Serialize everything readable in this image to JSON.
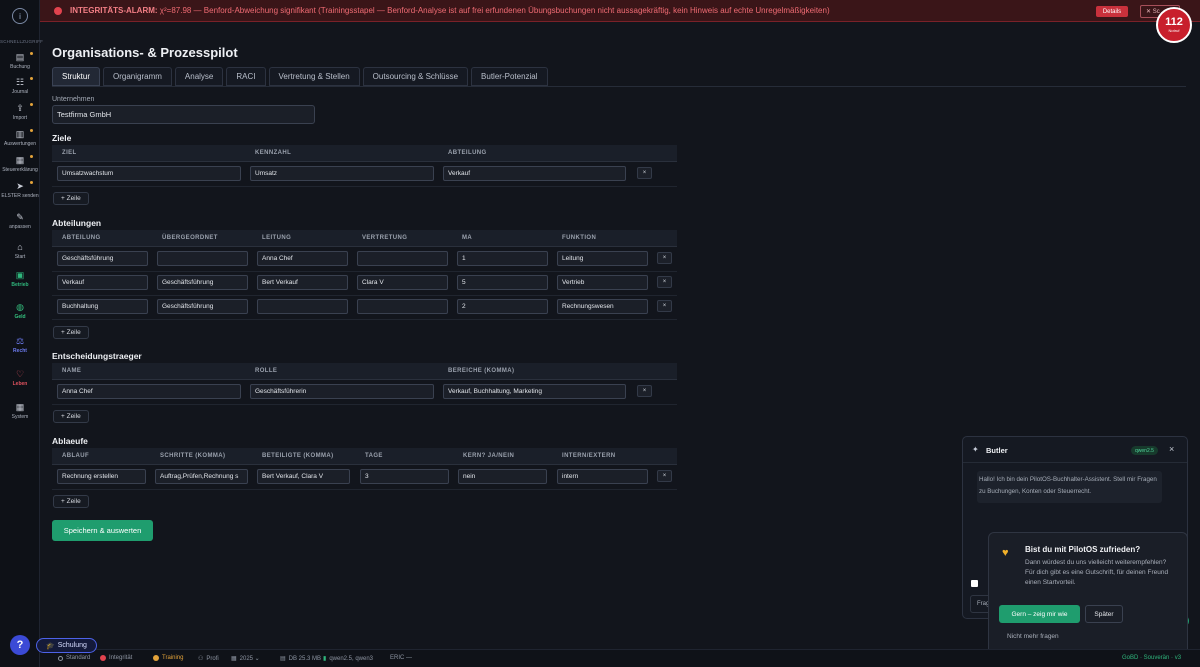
{
  "sidebar": {
    "logo": "i",
    "section": "SCHNELLZUGRIFF",
    "items": [
      {
        "label": "Buchung",
        "icon": "book-icon",
        "glyph": "▤",
        "dot": true
      },
      {
        "label": "Journal",
        "icon": "journal-icon",
        "glyph": "☷",
        "dot": true
      },
      {
        "label": "Import",
        "icon": "upload-icon",
        "glyph": "⇪",
        "dot": true
      },
      {
        "label": "Auswertungen",
        "icon": "chart-icon",
        "glyph": "▥",
        "dot": true
      },
      {
        "label": "Steuererklärung",
        "icon": "document-icon",
        "glyph": "▦",
        "dot": true
      },
      {
        "label": "ELSTER senden",
        "icon": "send-icon",
        "glyph": "➤",
        "dot": true
      },
      {
        "label": "anpassen",
        "icon": "pencil-icon",
        "glyph": "✎",
        "dot": false
      }
    ],
    "nav": [
      {
        "label": "Start",
        "icon": "home-icon",
        "glyph": "⌂",
        "color": "#c8ccd6",
        "sub": ""
      },
      {
        "label": "Betrieb",
        "icon": "briefcase-icon",
        "glyph": "▣",
        "color": "#2fb67c",
        "sub": ""
      },
      {
        "label": "Geld",
        "icon": "piggy-bank-icon",
        "glyph": "◍",
        "color": "#34c27f",
        "sub": ""
      },
      {
        "label": "Recht",
        "icon": "scales-icon",
        "glyph": "⚖",
        "color": "#6d7cf0",
        "sub": ""
      },
      {
        "label": "Leben",
        "icon": "heart-icon",
        "glyph": "♡",
        "color": "#e0525f",
        "sub": ""
      },
      {
        "label": "System",
        "icon": "grid-icon",
        "glyph": "▦",
        "color": "#c8ccd6",
        "sub": ""
      }
    ]
  },
  "alarm": {
    "label": "INTEGRITÄTS-ALARM:",
    "message": "χ²=87.98 — Benford-Abweichung signifikant (Trainingsstapel — Benford-Analyse ist auf frei erfundenen Übungsbuchungen nicht aussagekräftig, kein Hinweis auf echte Unregelmäßigkeiten)",
    "details_button": "Details",
    "close_button": "✕ Sc",
    "badge_number": "112",
    "badge_label": "Notruf"
  },
  "page": {
    "title": "Organisations- & Prozesspilot",
    "tabs": [
      "Struktur",
      "Organigramm",
      "Analyse",
      "RACI",
      "Vertretung & Stellen",
      "Outsourcing & Schlüsse",
      "Butler-Potenzial"
    ],
    "company_label": "Unternehmen",
    "company_value": "Testfirma GmbH",
    "add_row": "+ Zeile",
    "remove": "×",
    "save_button": "Speichern & auswerten"
  },
  "ziele": {
    "heading": "Ziele",
    "columns": [
      "ZIEL",
      "KENNZAHL",
      "ABTEILUNG"
    ],
    "rows": [
      [
        "Umsatzwachstum",
        "Umsatz",
        "Verkauf"
      ]
    ]
  },
  "abteilungen": {
    "heading": "Abteilungen",
    "columns": [
      "ABTEILUNG",
      "ÜBERGEORDNET",
      "LEITUNG",
      "VERTRETUNG",
      "MA",
      "FUNKTION"
    ],
    "rows": [
      [
        "Geschäftsführung",
        "",
        "Anna Chef",
        "",
        "1",
        "Leitung"
      ],
      [
        "Verkauf",
        "Geschäftsführung",
        "Bert Verkauf",
        "Clara V",
        "5",
        "Vertrieb"
      ],
      [
        "Buchhaltung",
        "Geschäftsführung",
        "",
        "",
        "2",
        "Rechnungswesen"
      ]
    ]
  },
  "entscheider": {
    "heading": "Entscheidungstraeger",
    "columns": [
      "NAME",
      "ROLLE",
      "BEREICHE (KOMMA)"
    ],
    "rows": [
      [
        "Anna Chef",
        "Geschäftsführerin",
        "Verkauf, Buchhaltung, Marketing"
      ]
    ]
  },
  "ablaeufe": {
    "heading": "Ablaeufe",
    "columns": [
      "ABLAUF",
      "SCHRITTE (KOMMA)",
      "BETEILIGTE (KOMMA)",
      "TAGE",
      "KERN? JA/NEIN",
      "INTERN/EXTERN"
    ],
    "rows": [
      [
        "Rechnung erstellen",
        "Auftrag,Prüfen,Rechnung s",
        "Bert Verkauf, Clara V",
        "3",
        "nein",
        "intern"
      ]
    ]
  },
  "butler": {
    "title": "Butler",
    "model": "qwen2.5",
    "close": "×",
    "message": "Hallo! Ich bin dein PilotOS-Buchhalter-Assistent. Stell mir Fragen zu Buchungen, Konten oder Steuerrecht.",
    "input_stub": "Frag",
    "popup_title": "Bist du mit PilotOS zufrieden?",
    "popup_text": "Dann würdest du uns vielleicht weiterempfehlen? Für dich gibt es eine Gutschrift, für deinen Freund einen Startvorteil.",
    "popup_yes": "Gern – zeig mir wie",
    "popup_later": "Später",
    "popup_never": "Nicht mehr fragen"
  },
  "status": {
    "help": "?",
    "schulung": "Schulung",
    "standard": "Standard",
    "integritaet": "Integrität",
    "training": "Training",
    "profi": "Profi",
    "year": "2025 ⌄",
    "db": "DB 25.3 MB",
    "models": "qwen2.5, qwen3",
    "eric": "ERIC —",
    "right": "GoBD · Souverän · v3"
  },
  "colors": {
    "accent": "#1f9d6e",
    "alarm": "#e2434e",
    "brand": "#3b4ad6"
  }
}
